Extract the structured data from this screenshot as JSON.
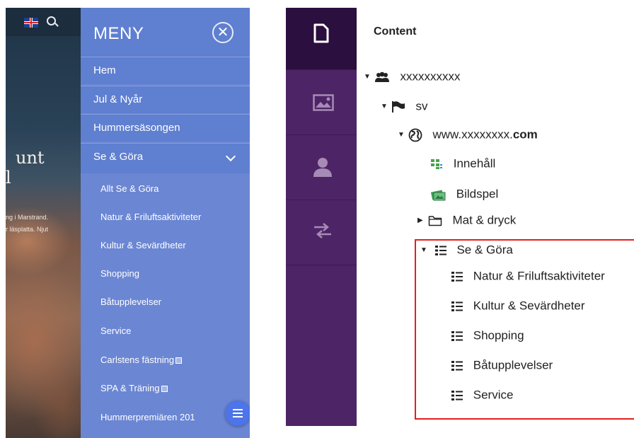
{
  "left_screenshot": {
    "hero": {
      "title_lines": [
        "unt",
        "l"
      ],
      "text_lines": [
        "ng i Marstrand.",
        "r läsplatta. Njut"
      ]
    },
    "menu": {
      "title": "MENY",
      "close_symbol": "✕",
      "items": [
        {
          "label": "Hem"
        },
        {
          "label": "Jul & Nyår"
        },
        {
          "label": "Hummersäsongen"
        },
        {
          "label": "Se & Göra",
          "expanded": true
        }
      ],
      "subitems": [
        {
          "label": "Allt Se & Göra"
        },
        {
          "label": "Natur & Friluftsaktiviteter"
        },
        {
          "label": "Kultur & Sevärdheter"
        },
        {
          "label": "Shopping"
        },
        {
          "label": "Båtupplevelser"
        },
        {
          "label": "Service"
        },
        {
          "label": "Carlstens fästning",
          "external": true
        },
        {
          "label": "SPA & Träning",
          "external": true
        },
        {
          "label": "Hummerpremiären 201"
        }
      ]
    },
    "colors": {
      "menu_bg": "#6b86d3",
      "menu_header_bg": "#5f7fd0",
      "fab": "#4d74e8"
    }
  },
  "right_screenshot": {
    "sidebar_icons": [
      "document-icon",
      "image-icon",
      "user-icon",
      "transfer-arrows-icon"
    ],
    "content_title": "Content",
    "tree": [
      {
        "label": "xxxxxxxxxx",
        "icon": "users-icon",
        "expanded": true
      },
      {
        "label": "sv",
        "icon": "flag-icon",
        "expanded": true
      },
      {
        "label_prefix": "www.xxxxxxxx.",
        "label_suffix": "com",
        "icon": "globe-icon",
        "expanded": true
      },
      {
        "label": "Innehåll",
        "icon": "grid-icon"
      },
      {
        "label": "Bildspel",
        "icon": "slideshow-icon"
      },
      {
        "label": "Mat & dryck",
        "icon": "folder-icon",
        "expanded": false
      },
      {
        "label": "Se & Göra",
        "icon": "list-icon",
        "expanded": true
      },
      {
        "label": "Natur & Friluftsaktiviteter",
        "icon": "list-icon"
      },
      {
        "label": "Kultur & Sevärdheter",
        "icon": "list-icon"
      },
      {
        "label": "Shopping",
        "icon": "list-icon"
      },
      {
        "label": "Båtupplevelser",
        "icon": "list-icon"
      },
      {
        "label": "Service",
        "icon": "list-icon"
      }
    ],
    "colors": {
      "sidebar_bg": "#4d2466",
      "sidebar_active_bg": "#2b0f3f",
      "highlight": "#e02020"
    }
  }
}
